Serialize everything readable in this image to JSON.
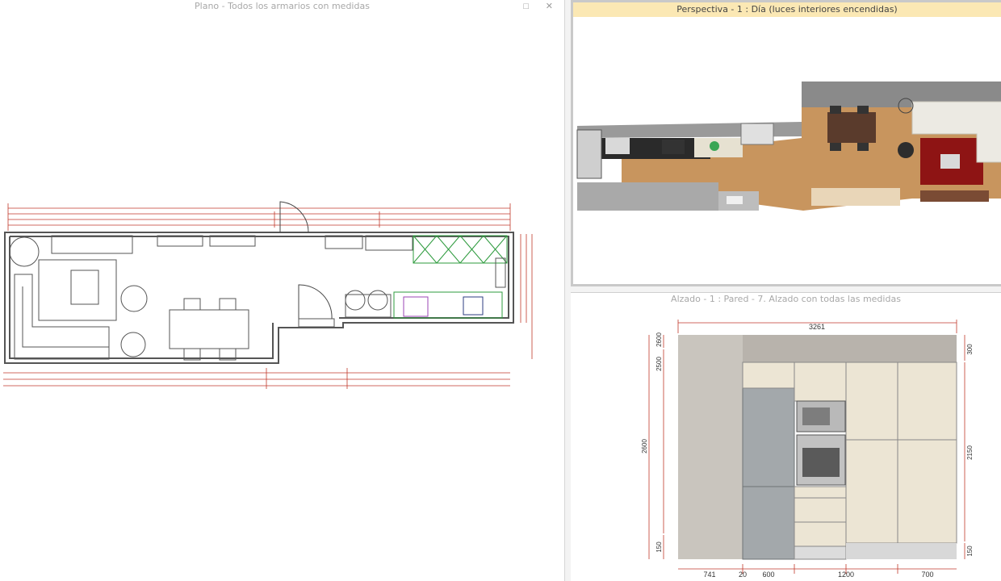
{
  "panels": {
    "plan": {
      "title": "Plano - Todos los armarios con medidas",
      "maximize_icon": "maximize-icon",
      "close_icon": "close-icon",
      "controls": {
        "maximize": "□",
        "close": "✕"
      }
    },
    "perspective": {
      "title": "Perspectiva - 1 : Día (luces interiores encendidas)"
    },
    "elevation": {
      "title": "Alzado - 1 : Pared - 7. Alzado con todas las medidas",
      "dimensions": {
        "total_width": "3261",
        "left_total": "2600",
        "left_upper": "2600",
        "left_mid": "2500",
        "left_lower": "150",
        "right_top": "300",
        "right_mid": "2150",
        "right_bottom": "150",
        "bottom_741": "741",
        "bottom_20": "20",
        "bottom_600": "600",
        "bottom_1200": "1200",
        "bottom_700": "700"
      }
    }
  },
  "colors": {
    "dimension_line": "#c0392b",
    "wall": "#555555",
    "cabinet_green": "#2e9b3e",
    "header_accent": "#fbe8b4",
    "wood_floor": "#c8955e",
    "rug_red": "#8e1414",
    "cabinet_cream": "#ece5d4",
    "appliance_grey": "#a3a8ab"
  }
}
